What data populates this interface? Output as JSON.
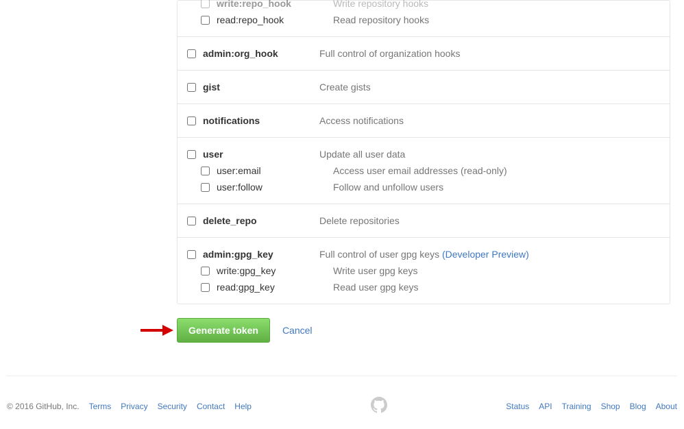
{
  "scopes": {
    "repo_hook": {
      "write": {
        "name": "write:repo_hook",
        "desc": "Write repository hooks"
      },
      "read": {
        "name": "read:repo_hook",
        "desc": "Read repository hooks"
      }
    },
    "admin_org_hook": {
      "name": "admin:org_hook",
      "desc": "Full control of organization hooks"
    },
    "gist": {
      "name": "gist",
      "desc": "Create gists"
    },
    "notifications": {
      "name": "notifications",
      "desc": "Access notifications"
    },
    "user": {
      "parent": {
        "name": "user",
        "desc": "Update all user data"
      },
      "email": {
        "name": "user:email",
        "desc": "Access user email addresses (read-only)"
      },
      "follow": {
        "name": "user:follow",
        "desc": "Follow and unfollow users"
      }
    },
    "delete_repo": {
      "name": "delete_repo",
      "desc": "Delete repositories"
    },
    "admin_gpg_key": {
      "parent": {
        "name": "admin:gpg_key",
        "desc_prefix": "Full control of user gpg keys ",
        "link": "(Developer Preview)"
      },
      "write": {
        "name": "write:gpg_key",
        "desc": "Write user gpg keys"
      },
      "read": {
        "name": "read:gpg_key",
        "desc": "Read user gpg keys"
      }
    }
  },
  "actions": {
    "generate": "Generate token",
    "cancel": "Cancel"
  },
  "footer": {
    "copyright": "© 2016 GitHub, Inc.",
    "left_links": [
      "Terms",
      "Privacy",
      "Security",
      "Contact",
      "Help"
    ],
    "right_links": [
      "Status",
      "API",
      "Training",
      "Shop",
      "Blog",
      "About"
    ]
  }
}
